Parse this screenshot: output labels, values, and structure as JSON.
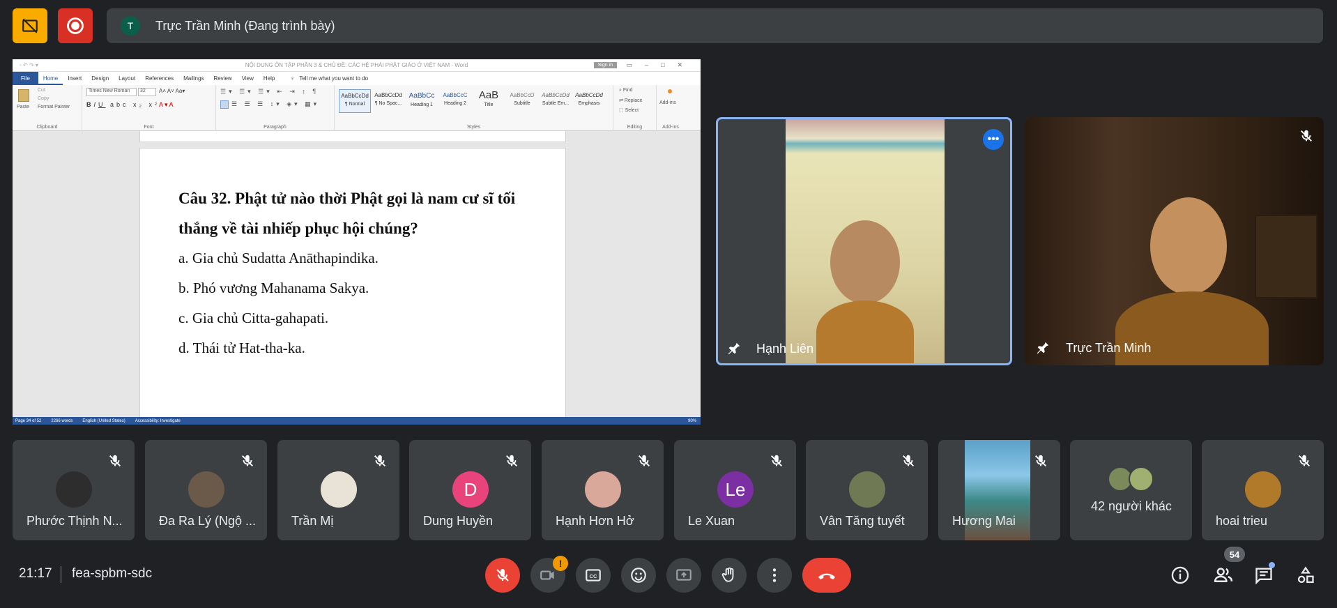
{
  "top": {
    "presenter_avatar": "T",
    "presenter_label": "Trực Trần Minh (Đang trình bày)",
    "colors": {
      "no_video_btn": "#f9ab00",
      "record_btn": "#d93025"
    }
  },
  "word": {
    "title": "NỘI DUNG ÔN TẬP PHẦN 3 & CHỦ ĐỀ: CÁC HỆ PHÁI PHẬT GIÁO Ở VIỆT NAM  -  Word",
    "sign_in": "Sign in",
    "tabs": [
      "File",
      "Home",
      "Insert",
      "Design",
      "Layout",
      "References",
      "Mailings",
      "Review",
      "View",
      "Help"
    ],
    "tell_me": "Tell me what you want to do",
    "clipboard": {
      "paste": "Paste",
      "cut": "Cut",
      "copy": "Copy",
      "format_painter": "Format Painter",
      "label": "Clipboard"
    },
    "font": {
      "name": "Times New Roman",
      "size": "32",
      "label": "Font"
    },
    "paragraph_label": "Paragraph",
    "styles": [
      {
        "sample": "AaBbCcDd",
        "name": "¶ Normal"
      },
      {
        "sample": "AaBbCcDd",
        "name": "¶ No Spac..."
      },
      {
        "sample": "AaBbCc",
        "name": "Heading 1"
      },
      {
        "sample": "AaBbCcC",
        "name": "Heading 2"
      },
      {
        "sample": "AaB",
        "name": "Title"
      },
      {
        "sample": "AaBbCcD",
        "name": "Subtitle"
      },
      {
        "sample": "AaBbCcDd",
        "name": "Subtle Em..."
      },
      {
        "sample": "AaBbCcDd",
        "name": "Emphasis"
      }
    ],
    "styles_label": "Styles",
    "editing": {
      "find": "Find",
      "replace": "Replace",
      "select": "Select",
      "label": "Editing"
    },
    "addins": {
      "button": "Add-ins",
      "label": "Add-ins"
    },
    "question": {
      "title": "Câu 32. Phật tử nào thời Phật gọi là nam cư sĩ tối thắng về tài nhiếp phục hội chúng?",
      "options": [
        "a. Gia chủ Sudatta Anāthapindika.",
        "b. Phó vương Mahanama Sakya.",
        "c. Gia chủ Citta-gahapati.",
        "d. Thái tử Hat-tha-ka."
      ]
    },
    "status": {
      "page": "Page 34 of 52",
      "words": "2266 words",
      "language": "English (United States)",
      "accessibility": "Accessibility: Investigate",
      "zoom": "90%"
    }
  },
  "main_tiles": [
    {
      "name": "Hạnh Liên"
    },
    {
      "name": "Trực Trần Minh"
    }
  ],
  "participants": [
    {
      "name": "Phước Thịnh N...",
      "avatar_type": "photo",
      "color": "#2d2d2d"
    },
    {
      "name": "Đa Ra Lý (Ngộ ...",
      "avatar_type": "photo",
      "color": "#6b5a4a"
    },
    {
      "name": "Trần Mị",
      "avatar_type": "photo",
      "color": "#e9e2d6"
    },
    {
      "name": "Dung Huyền",
      "avatar_type": "letter",
      "letter": "D",
      "color": "#e8437b"
    },
    {
      "name": "Hạnh Hơn Hở",
      "avatar_type": "photo",
      "color": "#d9a89a"
    },
    {
      "name": "Le Xuan",
      "avatar_type": "letter",
      "letter": "Le",
      "color": "#7b2fa3"
    },
    {
      "name": "Vân Tăng tuyết",
      "avatar_type": "photo",
      "color": "#6f7a55"
    },
    {
      "name": "Hương Mai",
      "avatar_type": "video",
      "color": "#5aa0c8"
    },
    {
      "name": "42 người khác",
      "avatar_type": "group",
      "color": "#7a8a5a"
    },
    {
      "name": "hoai trieu",
      "avatar_type": "photo",
      "color": "#b07a2a"
    }
  ],
  "bottom": {
    "time": "21:17",
    "meeting_code": "fea-spbm-sdc",
    "participant_count": "54",
    "camera_alert": "!"
  }
}
